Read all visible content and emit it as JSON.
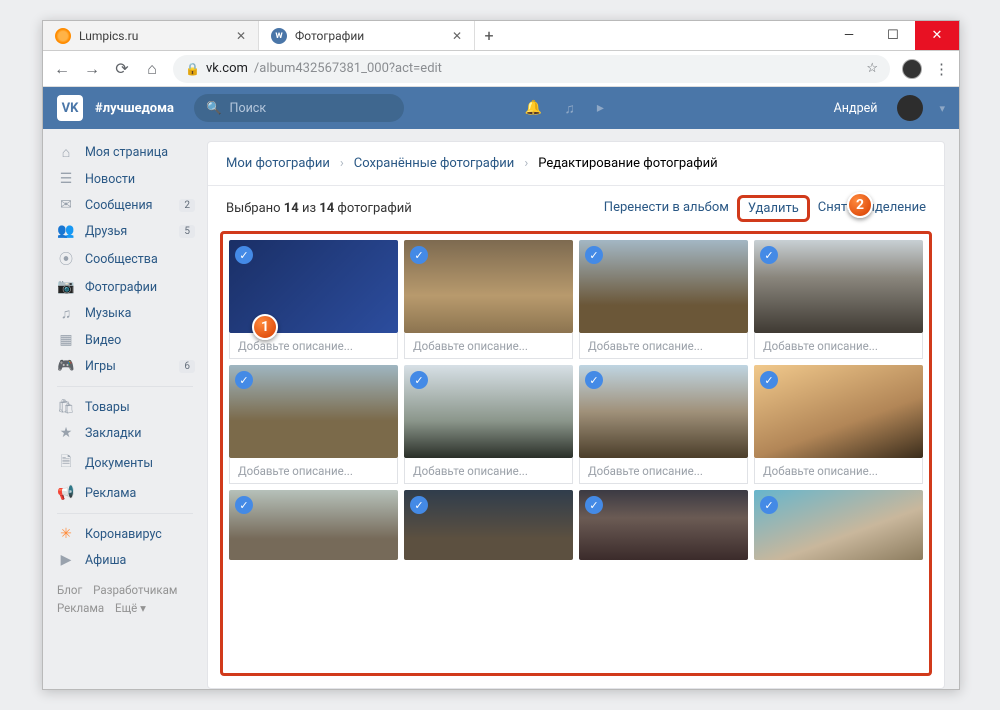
{
  "browser": {
    "tabs": [
      {
        "title": "Lumpics.ru",
        "active": false
      },
      {
        "title": "Фотографии",
        "active": true
      }
    ],
    "url_host": "vk.com",
    "url_path": "/album432567381_000?act=edit"
  },
  "vk": {
    "logo": "VK",
    "hashtag": "#лучшедома",
    "search_placeholder": "Поиск",
    "username": "Андрей",
    "sidebar": [
      {
        "icon": "home",
        "glyph": "⌂",
        "label": "Моя страница"
      },
      {
        "icon": "news",
        "glyph": "☰",
        "label": "Новости"
      },
      {
        "icon": "messages",
        "glyph": "✉",
        "label": "Сообщения",
        "badge": "2"
      },
      {
        "icon": "friends",
        "glyph": "👥",
        "label": "Друзья",
        "badge": "5"
      },
      {
        "icon": "groups",
        "glyph": "⦿",
        "label": "Сообщества"
      },
      {
        "icon": "photos",
        "glyph": "📷",
        "label": "Фотографии",
        "active": true
      },
      {
        "icon": "music",
        "glyph": "♫",
        "label": "Музыка"
      },
      {
        "icon": "video",
        "glyph": "▦",
        "label": "Видео"
      },
      {
        "icon": "games",
        "glyph": "🎮",
        "label": "Игры",
        "badge": "6"
      }
    ],
    "sidebar2": [
      {
        "icon": "market",
        "glyph": "🛍",
        "label": "Товары"
      },
      {
        "icon": "bookmarks",
        "glyph": "★",
        "label": "Закладки"
      },
      {
        "icon": "docs",
        "glyph": "🗎",
        "label": "Документы"
      },
      {
        "icon": "ads",
        "glyph": "📢",
        "label": "Реклама"
      }
    ],
    "sidebar3": [
      {
        "icon": "corona",
        "glyph": "✳",
        "label": "Коронавирус",
        "special": true
      },
      {
        "icon": "afisha",
        "glyph": "▶",
        "label": "Афиша"
      }
    ],
    "footer_links": [
      "Блог",
      "Разработчикам",
      "Реклама",
      "Ещё ▾"
    ]
  },
  "page": {
    "breadcrumb": [
      "Мои фотографии",
      "Сохранённые фотографии",
      "Редактирование фотографий"
    ],
    "selection_text_pre": "Выбрано ",
    "selection_count": "14",
    "selection_text_mid": " из ",
    "selection_total": "14",
    "selection_text_post": " фотографий",
    "actions": {
      "move": "Перенести в альбом",
      "delete": "Удалить",
      "deselect": "Снять выделение"
    },
    "desc_placeholder": "Добавьте описание...",
    "callouts": {
      "one": "1",
      "two": "2"
    }
  }
}
